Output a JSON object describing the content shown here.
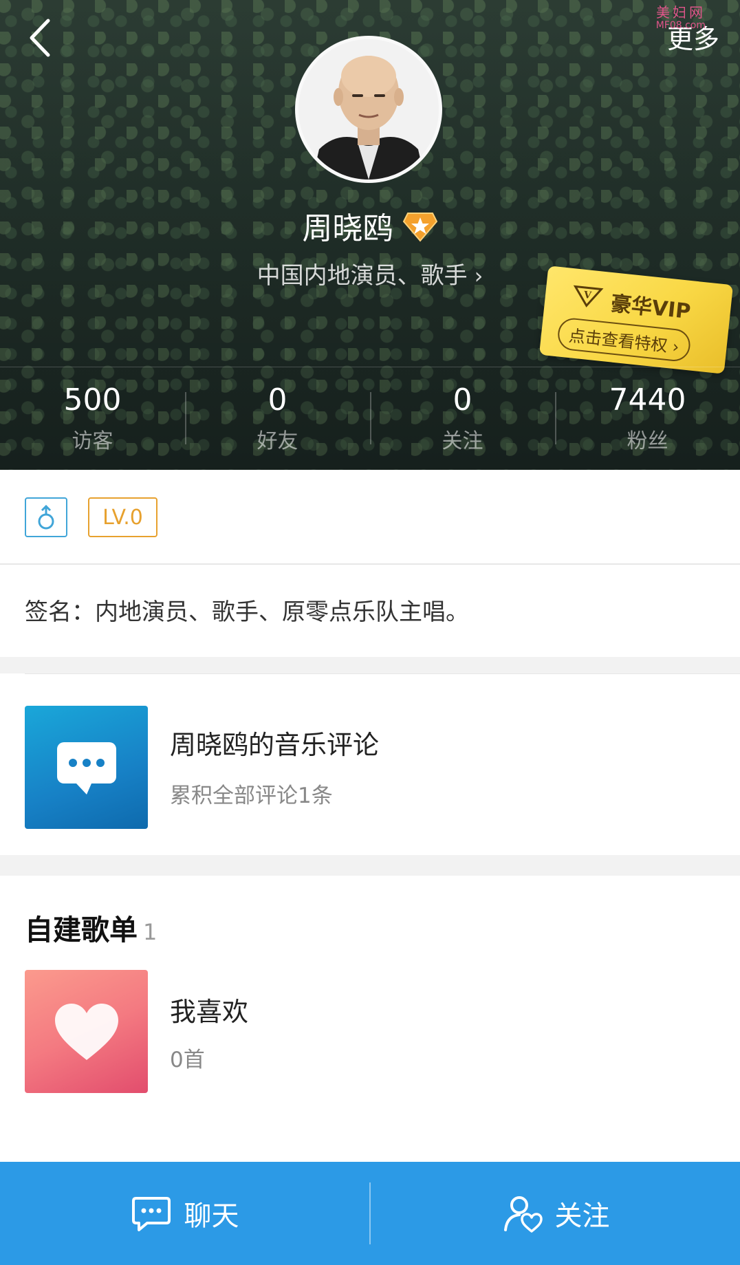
{
  "header": {
    "more_label": "更多",
    "watermark": {
      "cn": "美妇网",
      "en": "MF08.com"
    },
    "name": "周晓鸥",
    "description": "中国内地演员、歌手",
    "vip_card": {
      "title": "豪华VIP",
      "subtitle": "点击查看特权"
    },
    "stats": [
      {
        "value": "500",
        "label": "访客"
      },
      {
        "value": "0",
        "label": "好友"
      },
      {
        "value": "0",
        "label": "关注"
      },
      {
        "value": "7440",
        "label": "粉丝"
      }
    ]
  },
  "badges": {
    "level": "LV.0"
  },
  "signature": "签名：内地演员、歌手、原零点乐队主唱。",
  "comments": {
    "title": "周晓鸥的音乐评论",
    "subtitle": "累积全部评论1条"
  },
  "playlists": {
    "title": "自建歌单",
    "count": "1",
    "items": [
      {
        "name": "我喜欢",
        "tracks": "0首"
      }
    ]
  },
  "bottom_bar": {
    "chat_label": "聊天",
    "follow_label": "关注"
  },
  "colors": {
    "accent": "#2c9ae6",
    "level_badge": "#e7a12e",
    "gender_badge": "#40a5d8"
  }
}
